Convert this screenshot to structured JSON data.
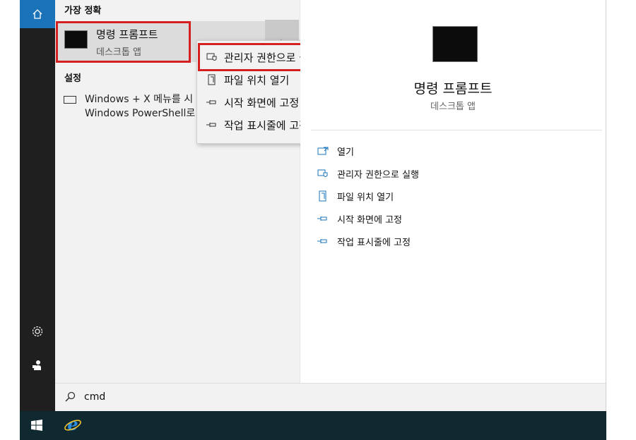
{
  "left_panel": {
    "best_match_heading": "가장 정확",
    "best_match": {
      "title": "명령 프롬프트",
      "subtitle": "데스크톱 앱"
    },
    "settings_heading": "설정",
    "settings_item": {
      "line1": "Windows + X 메뉴를 시",
      "line2": "Windows PowerShell로"
    }
  },
  "context_menu": {
    "items": [
      {
        "label": "관리자 권한으로 실행",
        "icon": "shield-icon"
      },
      {
        "label": "파일 위치 열기",
        "icon": "file-icon"
      },
      {
        "label": "시작 화면에 고정",
        "icon": "pin-icon"
      },
      {
        "label": "작업 표시줄에 고정",
        "icon": "pin-icon"
      }
    ]
  },
  "right_panel": {
    "title": "명령 프롬프트",
    "subtitle": "데스크톱 앱",
    "actions": [
      {
        "label": "열기",
        "icon": "open-icon"
      },
      {
        "label": "관리자 권한으로 실행",
        "icon": "shield-icon"
      },
      {
        "label": "파일 위치 열기",
        "icon": "file-icon"
      },
      {
        "label": "시작 화면에 고정",
        "icon": "pin-icon"
      },
      {
        "label": "작업 표시줄에 고정",
        "icon": "pin-icon"
      }
    ]
  },
  "search": {
    "value": "cmd"
  },
  "colors": {
    "highlight_border": "#d42020",
    "accent": "#1a73b8",
    "taskbar": "#102830",
    "rail": "#1f1f1f"
  }
}
